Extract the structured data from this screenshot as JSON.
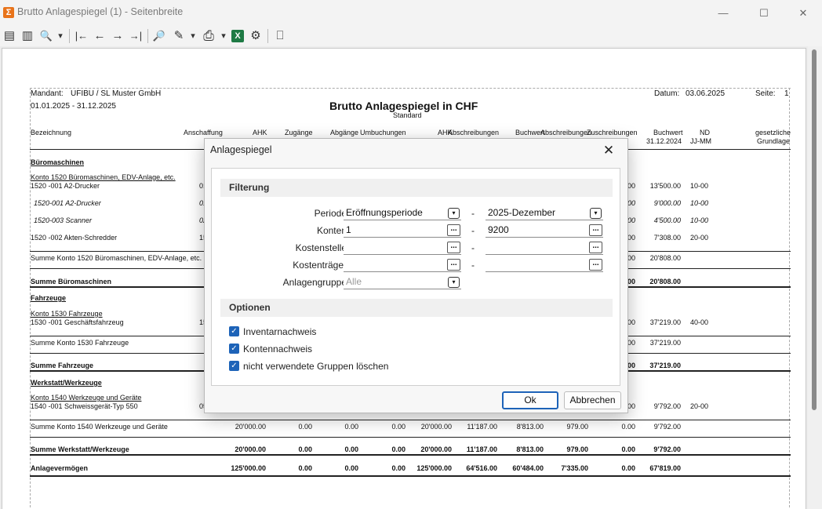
{
  "window": {
    "app_icon": "Σ",
    "title": "Brutto Anlagespiegel (1) - Seitenbreite",
    "minimize": "—",
    "maximize": "☐",
    "close": "✕"
  },
  "toolbar": {
    "icons": [
      "page-icon",
      "pages-icon",
      "zoom-icon",
      "first-page-icon",
      "prev-page-icon",
      "next-page-icon",
      "last-page-icon",
      "search-icon",
      "edit-icon",
      "print-icon",
      "excel-icon",
      "settings-icon",
      "exit-icon"
    ],
    "glyphs": {
      "page": "▤",
      "pages": "▥",
      "zoom": "🔍",
      "caret": "▾",
      "first": "|←",
      "prev": "←",
      "next": "→",
      "last": "→|",
      "search": "🔎",
      "edit": "✎",
      "print": "⎙",
      "excel": "X",
      "settings": "⚙",
      "exit": "⎕"
    }
  },
  "report": {
    "mandant_label": "Mandant:",
    "mandant_value": "UFIBU  /  SL Muster GmbH",
    "period": "01.01.2025 - 31.12.2025",
    "title": "Brutto Anlagespiegel in CHF",
    "subtitle": "Standard",
    "datum_label": "Datum:",
    "datum_value": "03.06.2025",
    "seite_label": "Seite:",
    "seite_value": "1",
    "headers": {
      "bezeichnung": "Bezeichnung",
      "anschaffung": "Anschaffung",
      "ahk": "AHK",
      "zugaenge": "Zugänge",
      "abgaenge": "Abgänge",
      "umbuchungen": "Umbuchungen",
      "ahk2": "AHK",
      "abschreibungen": "Abschreibungen",
      "buchwert": "Buchwert",
      "abschreibungen2": "Abschreibungen",
      "zuschreibungen": "Zuschreibungen",
      "buchwert2_line1": "Buchwert",
      "buchwert2_line2": "31.12.2024",
      "nd_line1": "ND",
      "nd_line2": "JJ-MM",
      "gesetzlich_line1": "gesetzliche",
      "gesetzlich_line2": "Grundlage"
    },
    "groups": {
      "bueromaschinen": "Büromaschinen",
      "konto1520": "Konto 1520 Büromaschinen, EDV-Anlage, etc.",
      "fahrzeuge": "Fahrzeuge",
      "konto1530": "Konto 1530 Fahrzeuge",
      "werkstatt": "Werkstatt/Werkzeuge",
      "konto1540": "Konto 1540 Werkzeuge und Geräte"
    },
    "rows": {
      "r1": {
        "name": "1520 -001 A2-Drucker",
        "date": "01",
        "x": "00",
        "bw": "13'500.00",
        "nd": "10-00"
      },
      "r2": {
        "name": "1520-001 A2-Drucker",
        "date": "01",
        "x": "00",
        "bw": "9'000.00",
        "nd": "10-00"
      },
      "r3": {
        "name": "1520-003 Scanner",
        "date": "02",
        "x": "00",
        "bw": "4'500.00",
        "nd": "10-00"
      },
      "r4": {
        "name": "1520 -002 Akten-Schredder",
        "date": "15",
        "x": "00",
        "bw": "7'308.00",
        "nd": "20-00"
      },
      "r5": {
        "name": "1530 -001 Geschäftsfahrzeug",
        "date": "15",
        "x": "00",
        "bw": "37'219.00",
        "nd": "40-00"
      },
      "r6": {
        "name": "1540 -001 Schweissgerät-Typ 550",
        "date": "05",
        "x": "00",
        "bw": "9'792.00",
        "nd": "20-00"
      }
    },
    "sums": {
      "s1520": {
        "label": "Summe Konto 1520 Büromaschinen, EDV-Anlage, etc.",
        "x": "00",
        "bw": "20'808.00"
      },
      "sbuero": {
        "label": "Summe Büromaschinen",
        "x": "00",
        "bw": "20'808.00"
      },
      "s1530": {
        "label": "Summe Konto 1530 Fahrzeuge",
        "x": "00",
        "bw": "37'219.00"
      },
      "sfahr": {
        "label": "Summe Fahrzeuge",
        "x": "00",
        "bw": "37'219.00"
      },
      "s1540": {
        "label": "Summe Konto 1540 Werkzeuge und Geräte",
        "ahk": "20'000.00",
        "zu": "0.00",
        "ab": "0.00",
        "um": "0.00",
        "ahk2": "20'000.00",
        "abs": "11'187.00",
        "bw": "8'813.00",
        "abs2": "979.00",
        "zus": "0.00",
        "bw2": "9'792.00"
      },
      "swerk": {
        "label": "Summe Werkstatt/Werkzeuge",
        "ahk": "20'000.00",
        "zu": "0.00",
        "ab": "0.00",
        "um": "0.00",
        "ahk2": "20'000.00",
        "abs": "11'187.00",
        "bw": "8'813.00",
        "abs2": "979.00",
        "zus": "0.00",
        "bw2": "9'792.00"
      },
      "sanlage": {
        "label": "Anlagevermögen",
        "ahk": "125'000.00",
        "zu": "0.00",
        "ab": "0.00",
        "um": "0.00",
        "ahk2": "125'000.00",
        "abs": "64'516.00",
        "bw": "60'484.00",
        "abs2": "7'335.00",
        "zus": "0.00",
        "bw2": "67'819.00"
      }
    }
  },
  "dialog": {
    "title": "Anlagespiegel",
    "close": "✕",
    "filter_section": "Filterung",
    "periode_label": "Periode",
    "periode_from": "Eröffnungsperiode",
    "periode_to": "2025-Dezember",
    "konten_label": "Konten",
    "konten_from": "1",
    "konten_to": "9200",
    "kostenstelle_label": "Kostenstelle",
    "kostentraeger_label": "Kostenträger",
    "anlagengruppe_label": "Anlagengruppe",
    "anlagengruppe_placeholder": "Alle",
    "range_dash": "-",
    "ellipsis": "...",
    "dropdown": "▾",
    "options_section": "Optionen",
    "opt_inventar": "Inventarnachweis",
    "opt_konten": "Kontennachweis",
    "opt_gruppen": "nicht verwendete Gruppen löschen",
    "check": "✓",
    "ok_label": "Ok",
    "cancel_label": "Abbrechen"
  }
}
